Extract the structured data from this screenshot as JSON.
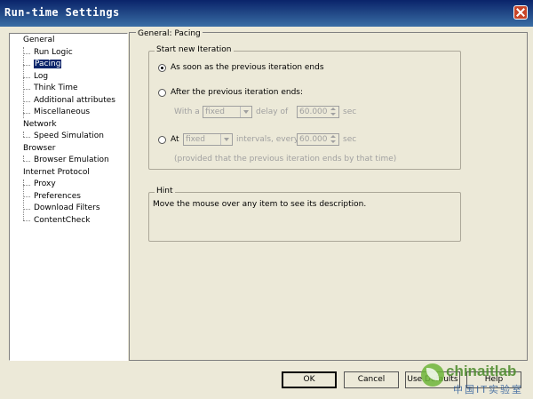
{
  "window": {
    "title": "Run-time Settings"
  },
  "tree": {
    "items": [
      {
        "label": "General",
        "level": 0
      },
      {
        "label": "Run Logic",
        "level": 1
      },
      {
        "label": "Pacing",
        "level": 1,
        "selected": true
      },
      {
        "label": "Log",
        "level": 1
      },
      {
        "label": "Think Time",
        "level": 1
      },
      {
        "label": "Additional attributes",
        "level": 1
      },
      {
        "label": "Miscellaneous",
        "level": 1
      },
      {
        "label": "Network",
        "level": 0
      },
      {
        "label": "Speed Simulation",
        "level": 1
      },
      {
        "label": "Browser",
        "level": 0
      },
      {
        "label": "Browser Emulation",
        "level": 1
      },
      {
        "label": "Internet Protocol",
        "level": 0
      },
      {
        "label": "Proxy",
        "level": 1
      },
      {
        "label": "Preferences",
        "level": 1
      },
      {
        "label": "Download Filters",
        "level": 1
      },
      {
        "label": "ContentCheck",
        "level": 1
      }
    ]
  },
  "page": {
    "title": "General: Pacing",
    "iteration_group": {
      "title": "Start new Iteration",
      "option1": "As soon as the previous iteration ends",
      "option2": "After the previous iteration ends:",
      "with_a": "With a",
      "combo1_value": "fixed",
      "delay_of": "delay of",
      "spin1_value": "60.000",
      "sec1": "sec",
      "option3": "At",
      "combo2_value": "fixed",
      "intervals_every": "intervals, every",
      "spin2_value": "60.000",
      "sec2": "sec",
      "provided_note": "(provided that the previous iteration ends by that time)"
    },
    "hint_group": {
      "title": "Hint",
      "text": "Move the mouse over any item to see its description."
    }
  },
  "buttons": {
    "ok": "OK",
    "cancel": "Cancel",
    "use_defaults": "Use Defaults",
    "help": "Help"
  },
  "watermark": {
    "brand": "chinaitlab",
    "sub": "中国IT实验室"
  }
}
